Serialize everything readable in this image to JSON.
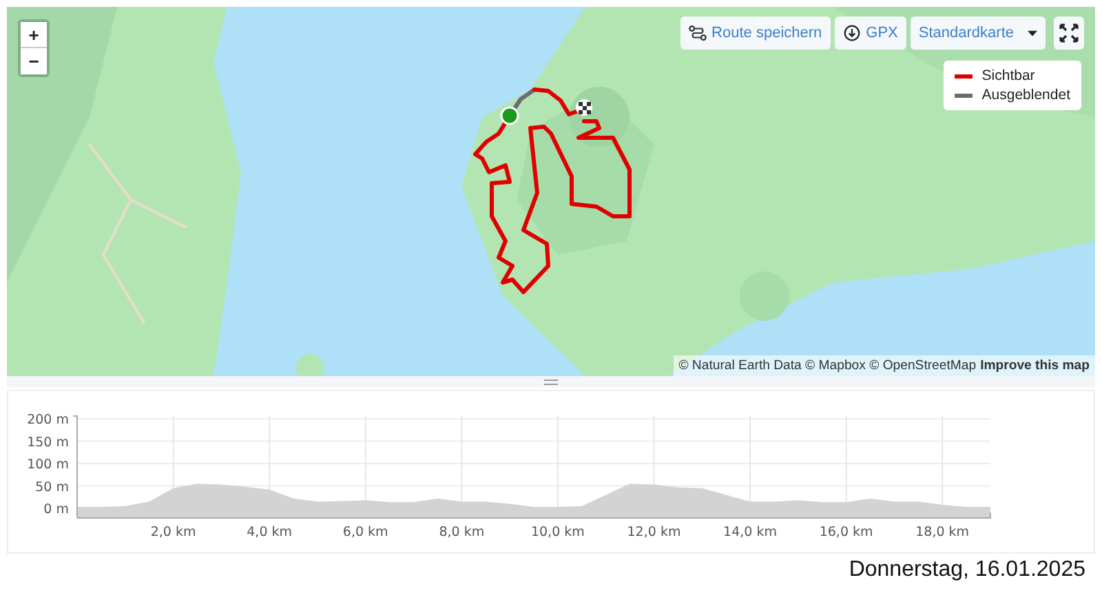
{
  "map": {
    "zoom_in": "+",
    "zoom_out": "−",
    "save_route": "Route speichern",
    "gpx": "GPX",
    "map_style": "Standardkarte",
    "legend": [
      {
        "label": "Sichtbar",
        "color": "#e00000"
      },
      {
        "label": "Ausgeblendet",
        "color": "#6b6b75"
      }
    ],
    "attribution": "© Natural Earth Data © Mapbox © OpenStreetMap",
    "attribution_link": "Improve this map"
  },
  "elevation_profile": {
    "chart_data": {
      "type": "area",
      "xlim": [
        0,
        19
      ],
      "ylim": [
        0,
        200
      ],
      "x": [
        0,
        0.5,
        1,
        1.5,
        2,
        2.5,
        3,
        3.5,
        4,
        4.5,
        5,
        5.5,
        6,
        6.5,
        7,
        7.5,
        8,
        8.5,
        9,
        9.5,
        10,
        10.5,
        11,
        11.5,
        12,
        12.5,
        13,
        13.5,
        14,
        14.5,
        15,
        15.5,
        16,
        16.5,
        17,
        17.5,
        18,
        18.5,
        19
      ],
      "grid": true,
      "series": [
        {
          "color": "#d3d3d3",
          "values": [
            3,
            3,
            5,
            15,
            45,
            55,
            53,
            48,
            42,
            22,
            15,
            16,
            18,
            14,
            14,
            22,
            15,
            15,
            10,
            3,
            3,
            5,
            30,
            55,
            53,
            47,
            45,
            30,
            15,
            15,
            18,
            14,
            14,
            22,
            15,
            15,
            8,
            3,
            3
          ]
        }
      ],
      "xticks": [
        {
          "value": 2,
          "label": "2,0 km"
        },
        {
          "value": 4,
          "label": "4,0 km"
        },
        {
          "value": 6,
          "label": "6,0 km"
        },
        {
          "value": 8,
          "label": "8,0 km"
        },
        {
          "value": 10,
          "label": "10,0 km"
        },
        {
          "value": 12,
          "label": "12,0 km"
        },
        {
          "value": 14,
          "label": "14,0 km"
        },
        {
          "value": 16,
          "label": "16,0 km"
        },
        {
          "value": 18,
          "label": "18,0 km"
        }
      ],
      "yticks": [
        {
          "value": 0,
          "label": "0 m"
        },
        {
          "value": 50,
          "label": "50 m"
        },
        {
          "value": 100,
          "label": "100 m"
        },
        {
          "value": 150,
          "label": "150 m"
        },
        {
          "value": 200,
          "label": "200 m"
        }
      ]
    }
  },
  "date": "Donnerstag, 16.01.2025"
}
